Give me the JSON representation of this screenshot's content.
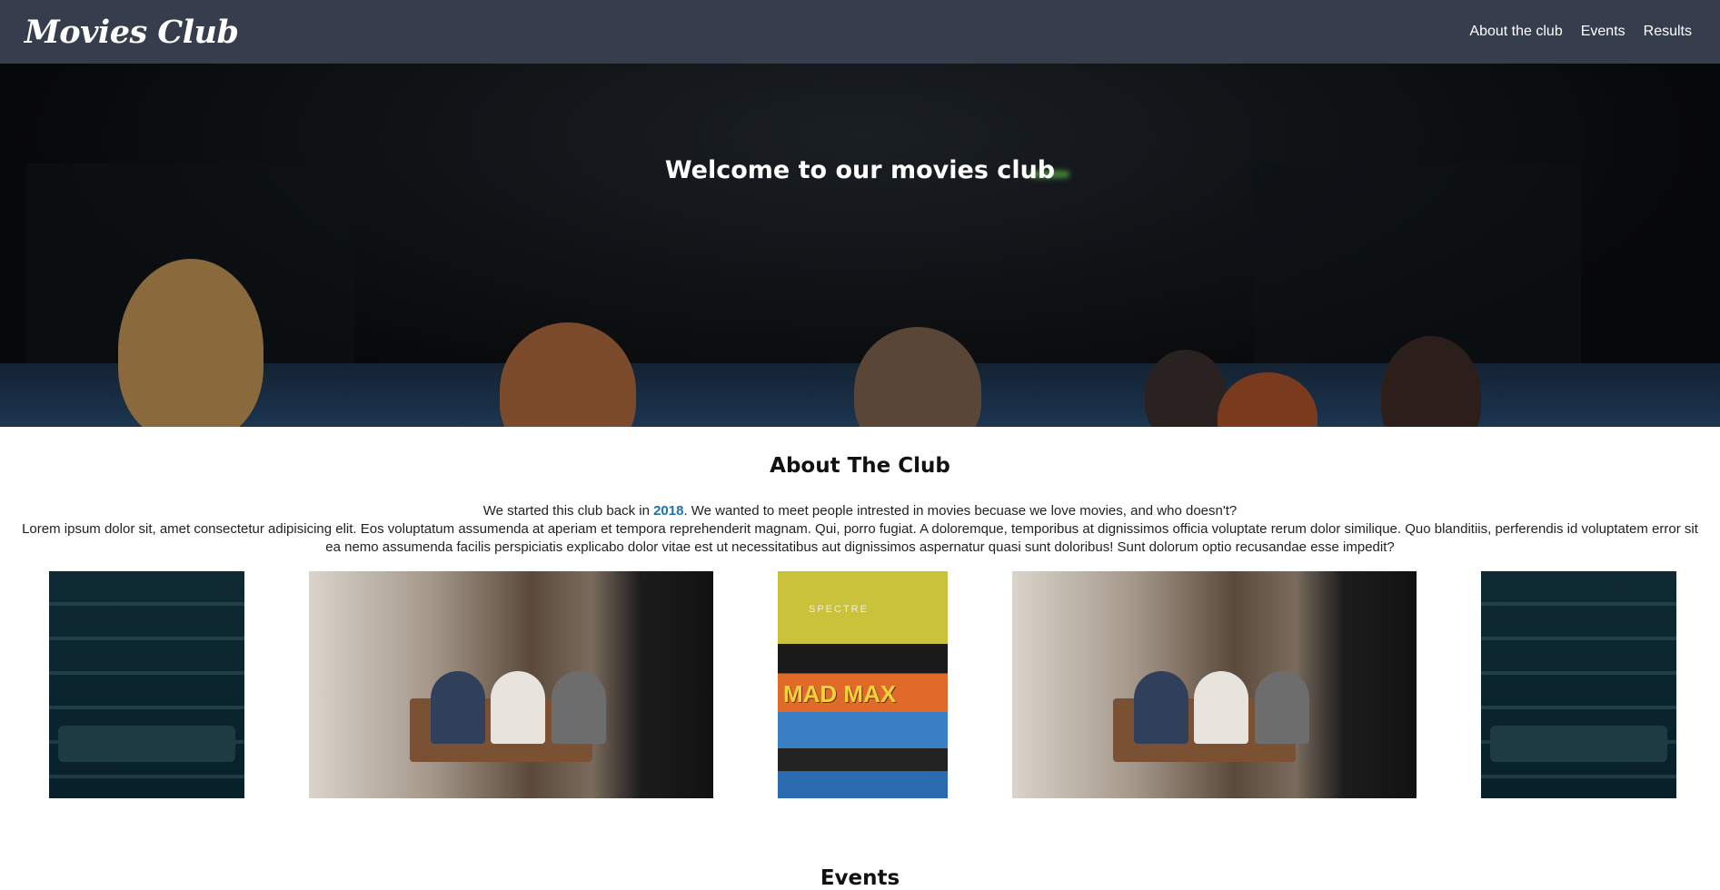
{
  "header": {
    "brand": "Movies Club",
    "nav": [
      "About the club",
      "Events",
      "Results"
    ]
  },
  "hero": {
    "title": "Welcome to our movies club"
  },
  "about": {
    "title": "About The Club",
    "intro_before": "We started this club back in ",
    "year": "2018",
    "intro_after": ". We wanted to meet people intrested in movies becuase we love movies, and who doesn't?",
    "body": "Lorem ipsum dolor sit, amet consectetur adipisicing elit. Eos voluptatum assumenda at aperiam et tempora reprehenderit magnam. Qui, porro fugiat. A doloremque, temporibus at dignissimos officia voluptate rerum dolor similique. Quo blanditiis, perferendis id voluptatem error sit ea nemo assumenda facilis perspiciatis explicabo dolor vitae est ut necessitatibus aut dignissimos aspernatur quasi sunt doloribus! Sunt dolorum optio recusandae esse impedit?"
  },
  "gallery": {
    "poster_text_1": "MAD MAX",
    "poster_text_2": "SPECTRE"
  },
  "next_section": {
    "title": "Events"
  },
  "colors": {
    "header_bg": "#363d4c",
    "accent": "#1a73b8"
  }
}
